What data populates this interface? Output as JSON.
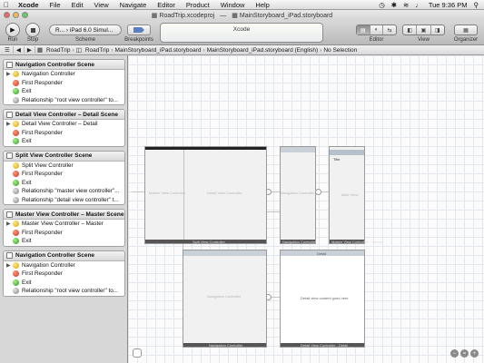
{
  "menubar": {
    "items": [
      "Xcode",
      "File",
      "Edit",
      "View",
      "Navigate",
      "Editor",
      "Product",
      "Window",
      "Help"
    ],
    "clock": "Tue 9:36 PM"
  },
  "window": {
    "project_file": "RoadTrip.xcodeproj",
    "storyboard_file": "MainStoryboard_iPad.storyboard"
  },
  "toolbar": {
    "run_label": "Run",
    "stop_label": "Stop",
    "scheme_value": "R... › iPad 6.0 Simul...",
    "scheme_label": "Scheme",
    "breakpoints_label": "Breakpoints",
    "activity_text": "Xcode",
    "editor_label": "Editor",
    "view_label": "View",
    "organizer_label": "Organizer"
  },
  "jumpbar": {
    "crumbs": [
      "RoadTrip",
      "RoadTrip",
      "MainStoryboard_iPad.storyboard",
      "MainStoryboard_iPad.storyboard (English)",
      "No Selection"
    ]
  },
  "outline": {
    "scenes": [
      {
        "title": "Navigation Controller Scene",
        "rows": [
          {
            "label": "Navigation Controller",
            "icon": "yellow",
            "expand": true
          },
          {
            "label": "First Responder",
            "icon": "red",
            "expand": false
          },
          {
            "label": "Exit",
            "icon": "green",
            "expand": false
          },
          {
            "label": "Relationship \"root view controller\" to...",
            "icon": "gray",
            "expand": false
          }
        ]
      },
      {
        "title": "Detail View Controller – Detail Scene",
        "rows": [
          {
            "label": "Detail View Controller – Detail",
            "icon": "yellow",
            "expand": true
          },
          {
            "label": "First Responder",
            "icon": "red",
            "expand": false
          },
          {
            "label": "Exit",
            "icon": "green",
            "expand": false
          }
        ]
      },
      {
        "title": "Split View Controller Scene",
        "rows": [
          {
            "label": "Split View Controller",
            "icon": "yellow",
            "expand": false
          },
          {
            "label": "First Responder",
            "icon": "red",
            "expand": false
          },
          {
            "label": "Exit",
            "icon": "green",
            "expand": false
          },
          {
            "label": "Relationship \"master view controller\"...",
            "icon": "gray",
            "expand": false
          },
          {
            "label": "Relationship \"detail view controller\" t...",
            "icon": "gray",
            "expand": false
          }
        ]
      },
      {
        "title": "Master View Controller – Master Scene",
        "rows": [
          {
            "label": "Master View Controller – Master",
            "icon": "yellow",
            "expand": true
          },
          {
            "label": "First Responder",
            "icon": "red",
            "expand": false
          },
          {
            "label": "Exit",
            "icon": "green",
            "expand": false
          }
        ]
      },
      {
        "title": "Navigation Controller Scene",
        "rows": [
          {
            "label": "Navigation Controller",
            "icon": "yellow",
            "expand": true
          },
          {
            "label": "First Responder",
            "icon": "red",
            "expand": false
          },
          {
            "label": "Exit",
            "icon": "green",
            "expand": false
          },
          {
            "label": "Relationship \"root view controller\" to...",
            "icon": "gray",
            "expand": false
          }
        ]
      }
    ]
  },
  "canvas": {
    "split_master_label": "Master View Controller",
    "split_detail_label": "Detail View Controller",
    "split_caption": "Split View Controller",
    "nav1_label": "Navigation Controller",
    "nav1_caption": "Navigation Controller",
    "master_nav_title": "Title",
    "master_body": "Table View",
    "master_caption": "Master View Controller - Master",
    "nav2_label": "Navigation Controller",
    "nav2_caption": "Navigation Controller",
    "detail_title": "Detail",
    "detail_body": "Detail view content goes here",
    "detail_caption": "Detail View Controller - Detail"
  }
}
